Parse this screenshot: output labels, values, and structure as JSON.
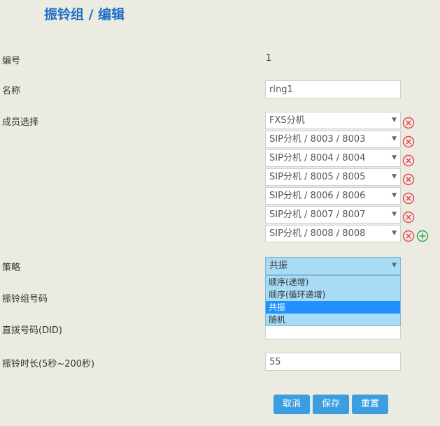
{
  "header": {
    "title": "振铃组 / 编辑"
  },
  "form": {
    "id_label": "编号",
    "id_value": "1",
    "name_label": "名称",
    "name_value": "ring1",
    "members_label": "成员选择",
    "members": [
      "FXS分机",
      "SIP分机 / 8003 / 8003",
      "SIP分机 / 8004 / 8004",
      "SIP分机 / 8005 / 8005",
      "SIP分机 / 8006 / 8006",
      "SIP分机 / 8007 / 8007",
      "SIP分机 / 8008 / 8008"
    ],
    "strategy_label": "策略",
    "strategy_value": "共振",
    "strategy_options": [
      "顺序(递增)",
      "顺序(循环递增)",
      "共振",
      "随机"
    ],
    "strategy_selected_index": 2,
    "group_number_label": "振铃组号码",
    "did_label": "直拨号码(DID)",
    "ring_duration_label": "振铃时长(5秒~200秒)",
    "ring_duration_value": "55"
  },
  "buttons": {
    "cancel": "取消",
    "save": "保存",
    "reset": "重置"
  },
  "colors": {
    "accent": "#3a9ee0",
    "title": "#1f6fc5",
    "remove": "#e8414b",
    "add": "#2aa84a"
  },
  "icons": {
    "remove": "remove-circle-icon",
    "add": "add-circle-icon",
    "dropdown": "chevron-down-icon"
  }
}
